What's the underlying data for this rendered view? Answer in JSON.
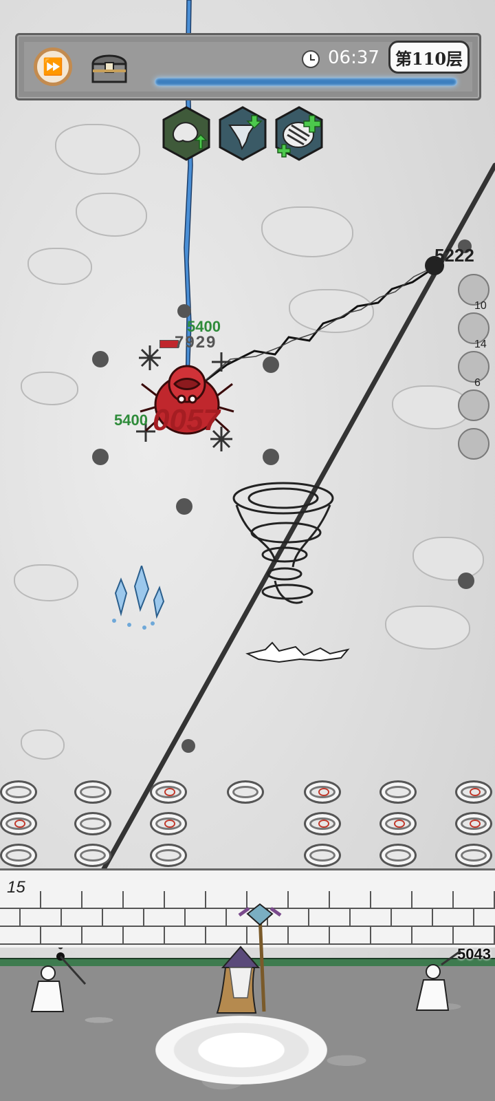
{
  "hud": {
    "timer": "06:37",
    "floor": "第110层",
    "fast_forward_icon": "fast-forward-icon",
    "chest_icon": "treasure-chest-icon",
    "clock_icon": "clock-icon"
  },
  "skills": [
    {
      "name": "poison-splash-upgrade-icon"
    },
    {
      "name": "tornado-add-icon"
    },
    {
      "name": "claw-slash-add-icon"
    }
  ],
  "side_slots": [
    {
      "label": "10"
    },
    {
      "label": "14"
    },
    {
      "label": "6"
    },
    {
      "label": ""
    },
    {
      "label": ""
    }
  ],
  "damage_numbers": {
    "enemy_hp": "7929",
    "heal_top": "5400",
    "heal_left": "5400",
    "big_hit": "0057",
    "right_hit": "5222"
  },
  "wave_count": "15",
  "wall_hp": "5043",
  "colors": {
    "enemy": "#c0272d",
    "heal_text": "#2e8b3a",
    "lightning": "#3b82c4",
    "hp_bar": "#3e7b4f"
  }
}
